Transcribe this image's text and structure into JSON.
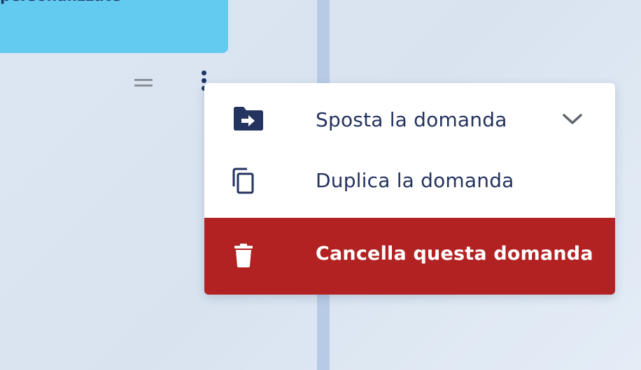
{
  "background_card": {
    "text": "personalizzate"
  },
  "menu": {
    "items": [
      {
        "label": "Sposta la domanda",
        "icon": "folder-move-icon",
        "has_submenu": true
      },
      {
        "label": "Duplica la domanda",
        "icon": "copy-icon"
      },
      {
        "label": "Cancella questa domanda",
        "icon": "trash-icon",
        "destructive": true
      }
    ]
  },
  "colors": {
    "card": "#62cbef",
    "text_dark": "#24335f",
    "danger": "#b22222",
    "divider": "#b8cbe6"
  }
}
